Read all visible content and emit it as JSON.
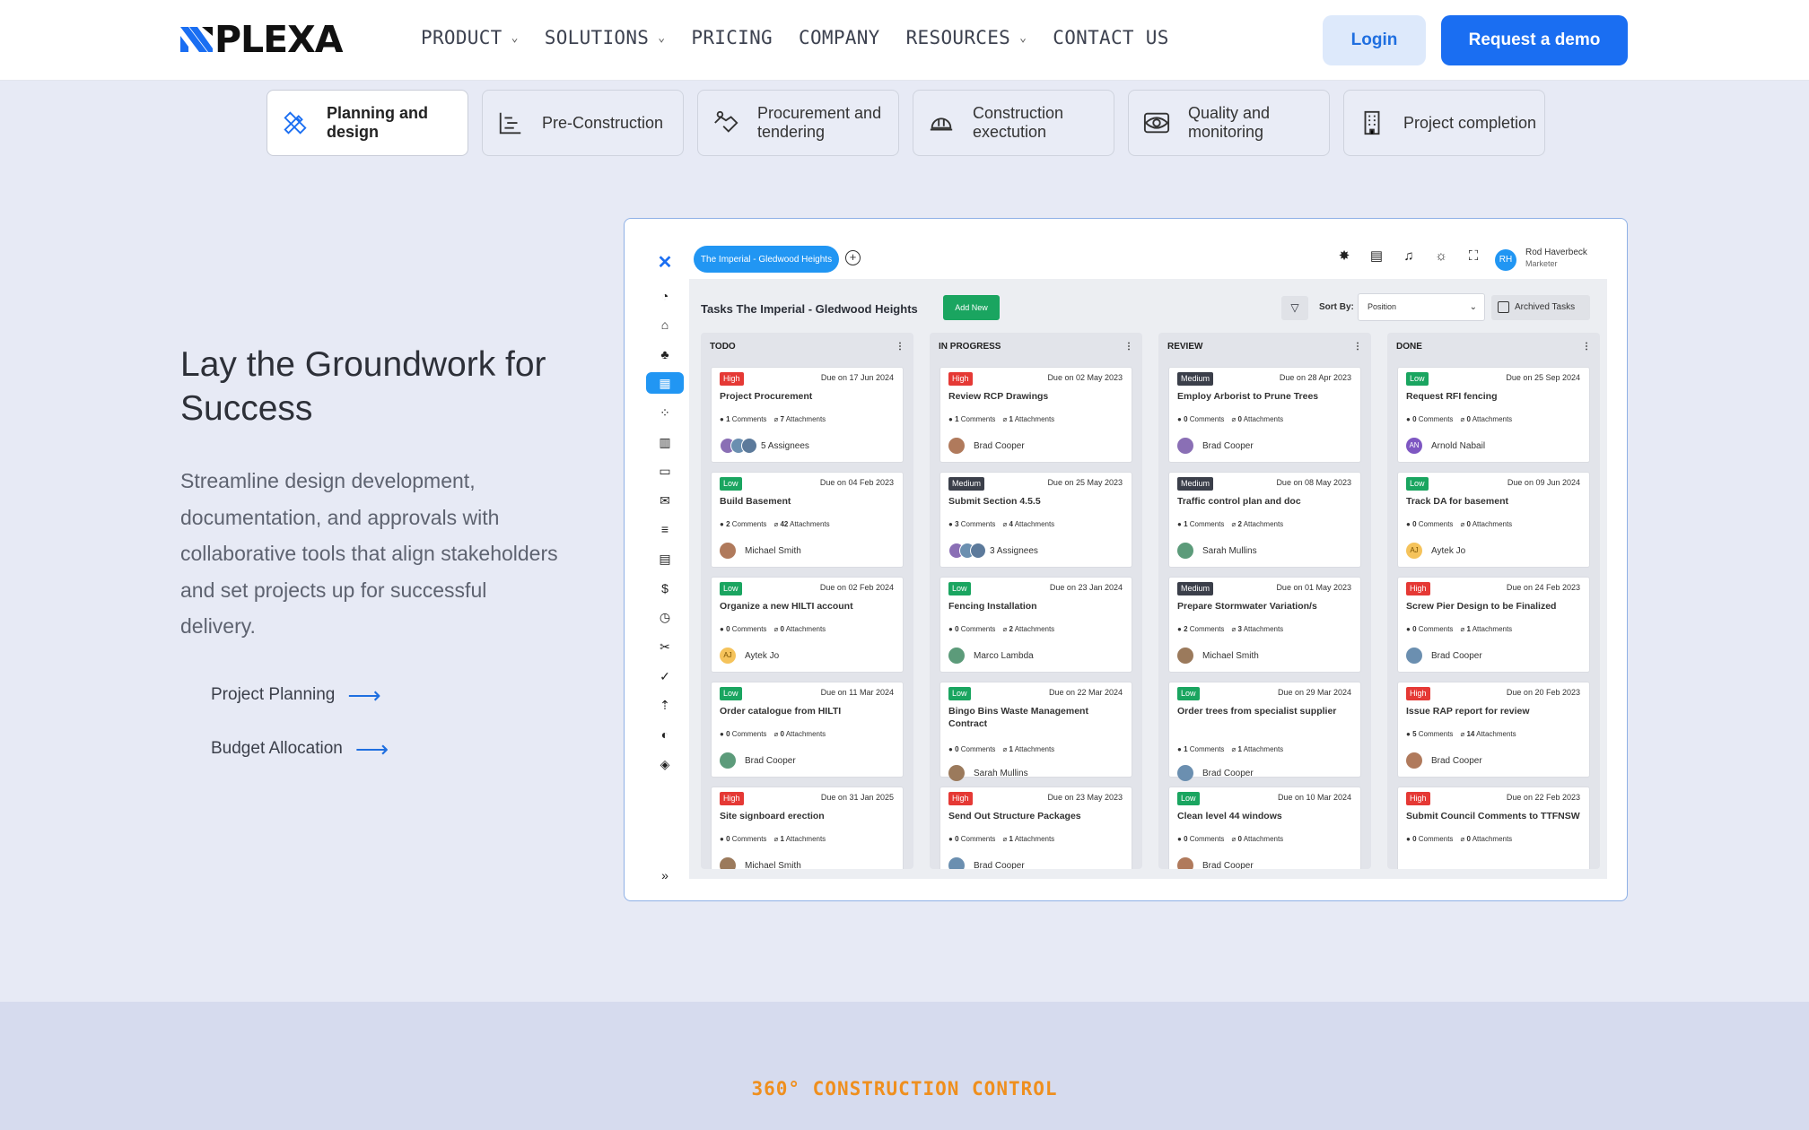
{
  "nav": {
    "logo_text": "PLEXA",
    "items": [
      {
        "label": "PRODUCT",
        "dropdown": true
      },
      {
        "label": "SOLUTIONS",
        "dropdown": true
      },
      {
        "label": "PRICING",
        "dropdown": false
      },
      {
        "label": "COMPANY",
        "dropdown": false
      },
      {
        "label": "RESOURCES",
        "dropdown": true
      },
      {
        "label": "CONTACT US",
        "dropdown": false
      }
    ],
    "login": "Login",
    "demo": "Request a demo",
    "brand_color": "#1a6ef2"
  },
  "phases": [
    {
      "label": "Planning and design",
      "icon": "pencil-ruler-icon",
      "active": true
    },
    {
      "label": "Pre-Construction",
      "icon": "gantt-icon",
      "active": false
    },
    {
      "label": "Procurement and tendering",
      "icon": "handshake-icon",
      "active": false
    },
    {
      "label": "Construction exectution",
      "icon": "hardhat-icon",
      "active": false
    },
    {
      "label": "Quality and monitoring",
      "icon": "eye-icon",
      "active": false
    },
    {
      "label": "Project completion",
      "icon": "building-icon",
      "active": false
    }
  ],
  "hero": {
    "title": "Lay the Groundwork for Success",
    "description": "Streamline design development, documentation, and approvals with collaborative tools that align stakeholders and set projects up for successful delivery.",
    "links": [
      "Project Planning",
      "Budget Allocation"
    ]
  },
  "app": {
    "project_pill": "The Imperial - Gledwood Heights",
    "user_initials": "RH",
    "user_name": "Rod Haverbeck",
    "user_role": "Marketer",
    "board_title": "Tasks The Imperial - Gledwood Heights",
    "add_new": "Add New",
    "sort_label": "Sort By:",
    "sort_value": "Position",
    "archived": "Archived Tasks",
    "priority_colors": {
      "High": "#e53935",
      "Medium": "#3b3f4a",
      "Low": "#1aa560"
    },
    "columns": [
      {
        "title": "TODO",
        "cards": [
          {
            "priority": "High",
            "due": "Due on 17 Jun 2024",
            "title": "Project Procurement",
            "comments": "1",
            "attachments": "7",
            "assignee": "5 Assignees",
            "multi": true
          },
          {
            "priority": "Low",
            "due": "Due on 04 Feb 2023",
            "title": "Build Basement",
            "comments": "2",
            "attachments": "42",
            "assignee": "Michael Smith"
          },
          {
            "priority": "Low",
            "due": "Due on 02 Feb 2024",
            "title": "Organize a new HILTI account",
            "comments": "0",
            "attachments": "0",
            "assignee": "Aytek Jo",
            "initials": "AJ"
          },
          {
            "priority": "Low",
            "due": "Due on 11 Mar 2024",
            "title": "Order catalogue from HILTI",
            "comments": "0",
            "attachments": "0",
            "assignee": "Brad Cooper"
          },
          {
            "priority": "High",
            "due": "Due on 31 Jan 2025",
            "title": "Site signboard erection",
            "comments": "0",
            "attachments": "1",
            "assignee": "Michael Smith"
          }
        ]
      },
      {
        "title": "IN PROGRESS",
        "cards": [
          {
            "priority": "High",
            "due": "Due on 02 May 2023",
            "title": "Review RCP Drawings",
            "comments": "1",
            "attachments": "1",
            "assignee": "Brad Cooper"
          },
          {
            "priority": "Medium",
            "due": "Due on 25 May 2023",
            "title": "Submit Section 4.5.5",
            "comments": "3",
            "attachments": "4",
            "assignee": "3 Assignees",
            "multi": true
          },
          {
            "priority": "Low",
            "due": "Due on 23 Jan 2024",
            "title": "Fencing Installation",
            "comments": "0",
            "attachments": "2",
            "assignee": "Marco Lambda"
          },
          {
            "priority": "Low",
            "due": "Due on 22 Mar 2024",
            "title": "Bingo Bins Waste Management Contract",
            "comments": "0",
            "attachments": "1",
            "assignee": "Sarah Mullins"
          },
          {
            "priority": "High",
            "due": "Due on 23 May 2023",
            "title": "Send Out Structure Packages",
            "comments": "0",
            "attachments": "1",
            "assignee": "Brad Cooper"
          }
        ]
      },
      {
        "title": "REVIEW",
        "cards": [
          {
            "priority": "Medium",
            "due": "Due on 28 Apr 2023",
            "title": "Employ Arborist to Prune Trees",
            "comments": "0",
            "attachments": "0",
            "assignee": "Brad Cooper"
          },
          {
            "priority": "Medium",
            "due": "Due on 08 May 2023",
            "title": "Traffic control plan and doc",
            "comments": "1",
            "attachments": "2",
            "assignee": "Sarah Mullins"
          },
          {
            "priority": "Medium",
            "due": "Due on 01 May 2023",
            "title": "Prepare Stormwater Variation/s",
            "comments": "2",
            "attachments": "3",
            "assignee": "Michael Smith"
          },
          {
            "priority": "Low",
            "due": "Due on 29 Mar 2024",
            "title": "Order trees from specialist supplier",
            "comments": "1",
            "attachments": "1",
            "assignee": "Brad Cooper"
          },
          {
            "priority": "Low",
            "due": "Due on 10 Mar 2024",
            "title": "Clean level 44 windows",
            "comments": "0",
            "attachments": "0",
            "assignee": "Brad Cooper"
          }
        ]
      },
      {
        "title": "DONE",
        "cards": [
          {
            "priority": "Low",
            "due": "Due on 25 Sep 2024",
            "title": "Request RFI fencing",
            "comments": "0",
            "attachments": "0",
            "assignee": "Arnold Nabail",
            "initials": "AN"
          },
          {
            "priority": "Low",
            "due": "Due on 09 Jun 2024",
            "title": "Track DA for basement",
            "comments": "0",
            "attachments": "0",
            "assignee": "Aytek Jo",
            "initials": "AJ"
          },
          {
            "priority": "High",
            "due": "Due on 24 Feb 2023",
            "title": "Screw Pier Design to be Finalized",
            "comments": "0",
            "attachments": "1",
            "assignee": "Brad Cooper"
          },
          {
            "priority": "High",
            "due": "Due on 20 Feb 2023",
            "title": "Issue RAP report for review",
            "comments": "5",
            "attachments": "14",
            "assignee": "Brad Cooper"
          },
          {
            "priority": "High",
            "due": "Due on 22 Feb 2023",
            "title": "Submit Council Comments to TTFNSW",
            "comments": "0",
            "attachments": "0",
            "assignee": ""
          }
        ]
      }
    ],
    "comments_word": "Comments",
    "attachments_word": "Attachments"
  },
  "section2": {
    "eyebrow": "360° CONSTRUCTION CONTROL"
  }
}
